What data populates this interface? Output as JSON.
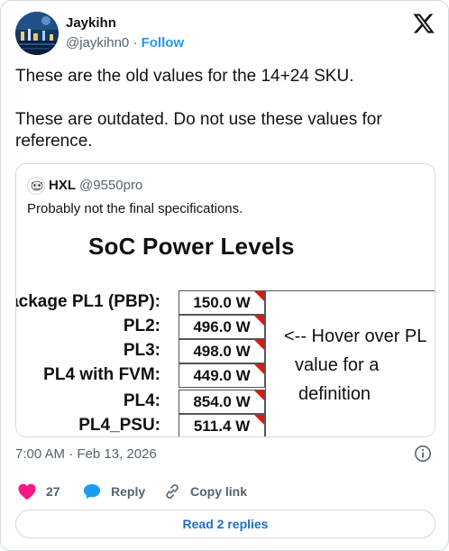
{
  "author": {
    "name": "Jaykihn",
    "handle": "@jaykihn0",
    "separator": "·",
    "follow_label": "Follow"
  },
  "tweet": {
    "paragraph1": "These are the old values for the 14+24 SKU.",
    "paragraph2": "These are outdated. Do not use these values for reference."
  },
  "quote": {
    "name": "HXL",
    "handle": "@9550pro",
    "text": "Probably not the final specifications.",
    "image": {
      "title": "SoC Power Levels",
      "rows": [
        {
          "label": "ackage PL1 (PBP):",
          "value": "150.0 W"
        },
        {
          "label": "PL2:",
          "value": "496.0 W"
        },
        {
          "label": "PL3:",
          "value": "498.0 W"
        },
        {
          "label": "PL4 with FVM:",
          "value": "449.0 W"
        },
        {
          "label": "PL4:",
          "value": "854.0 W"
        },
        {
          "label": "PL4_PSU:",
          "value": "511.4 W"
        }
      ],
      "hover_lines": [
        "<-- Hover over PL",
        "value for a",
        "definition"
      ],
      "marker_color": "#e0180f"
    }
  },
  "meta": {
    "timestamp": "7:00 AM · Feb 13, 2026"
  },
  "actions": {
    "likes_count": "27",
    "reply_label": "Reply",
    "copy_link_label": "Copy link"
  },
  "replies_button": "Read 2 replies",
  "colors": {
    "accent": "#1d9bf0",
    "like": "#f91880",
    "secondary_text": "#536471"
  }
}
